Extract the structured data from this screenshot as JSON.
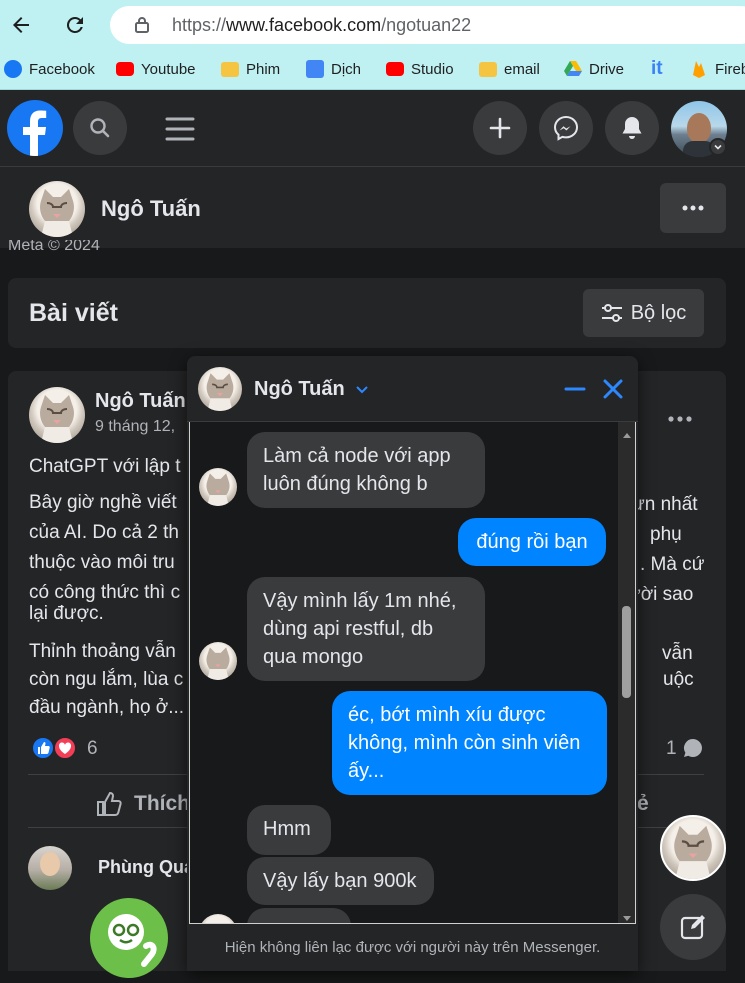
{
  "browser": {
    "url_prefix": "https://",
    "url_domain": "www.facebook.com",
    "url_path": "/ngotuan22",
    "bookmarks": [
      {
        "label": "Facebook",
        "icon": "facebook-icon",
        "color": "#1877f2"
      },
      {
        "label": "Youtube",
        "icon": "youtube-icon",
        "color": "#ff0000"
      },
      {
        "label": "Phim",
        "icon": "folder-icon",
        "color": "#f5c542"
      },
      {
        "label": "Dịch",
        "icon": "translate-icon",
        "color": "#4285f4"
      },
      {
        "label": "Studio",
        "icon": "youtube-icon",
        "color": "#ff0000"
      },
      {
        "label": "email",
        "icon": "folder-icon",
        "color": "#f5c542"
      },
      {
        "label": "Drive",
        "icon": "drive-icon",
        "color": "#34a853"
      },
      {
        "label": "it",
        "icon": "it-icon",
        "color": "#3b82f6"
      },
      {
        "label": "Fireb",
        "icon": "firebase-icon",
        "color": "#ffa000"
      }
    ]
  },
  "profile": {
    "name": "Ngô Tuấn",
    "meta_text": "Meta © 2024"
  },
  "posts_section": {
    "title": "Bài viết",
    "filter_label": "Bộ lọc"
  },
  "post": {
    "author": "Ngô Tuấn",
    "date_partial": "9 tháng 12,",
    "line1": "ChatGPT với lập t",
    "p2_l1_left": "Bây giờ nghề viết",
    "p2_l1_right": "ựn nhất",
    "p2_l2_left": "của AI. Do cả 2 th",
    "p2_l2_right": "phụ",
    "p2_l3_left": "thuộc vào môi tru",
    "p2_l3_right": ". Mà cứ",
    "p2_l4_left": "có công thức thì c",
    "p2_l4_right": "ười sao",
    "p2_l5": "lại được.",
    "p3_l1_left": "Thỉnh thoảng vẫn",
    "p3_l1_right": "vẫn",
    "p3_l2_left": "còn ngu lắm, lùa c",
    "p3_l2_right": "uộc",
    "p3_l3": "đầu ngành, họ ở...",
    "reactions_count": "6",
    "comments_count": "1",
    "like_label": "Thích",
    "share_partial": "ẻ",
    "commenter": "Phùng Qua"
  },
  "chat": {
    "name": "Ngô Tuấn",
    "messages": [
      {
        "from": "them",
        "text_l1": "Làm cả node với app",
        "text_l2": "luôn đúng không b"
      },
      {
        "from": "me",
        "text_l1": "đúng rồi bạn"
      },
      {
        "from": "them",
        "text_l1": "Vậy mình lấy 1m nhé,",
        "text_l2": "dùng api restful, db",
        "text_l3": "qua mongo"
      },
      {
        "from": "me",
        "text_l1": "éc, bớt mình xíu được",
        "text_l2": "không, mình còn sinh viên",
        "text_l3": "ấy..."
      },
      {
        "from": "them",
        "text_l1": "Hmm"
      },
      {
        "from": "them",
        "text_l1": "Vậy lấy bạn 900k"
      }
    ],
    "footer_note": "Hiện không liên lạc được với người này trên Messenger."
  },
  "colors": {
    "fb_blue": "#1877f2",
    "messenger_blue": "#0084ff",
    "surface": "#242526",
    "background": "#18191a"
  }
}
